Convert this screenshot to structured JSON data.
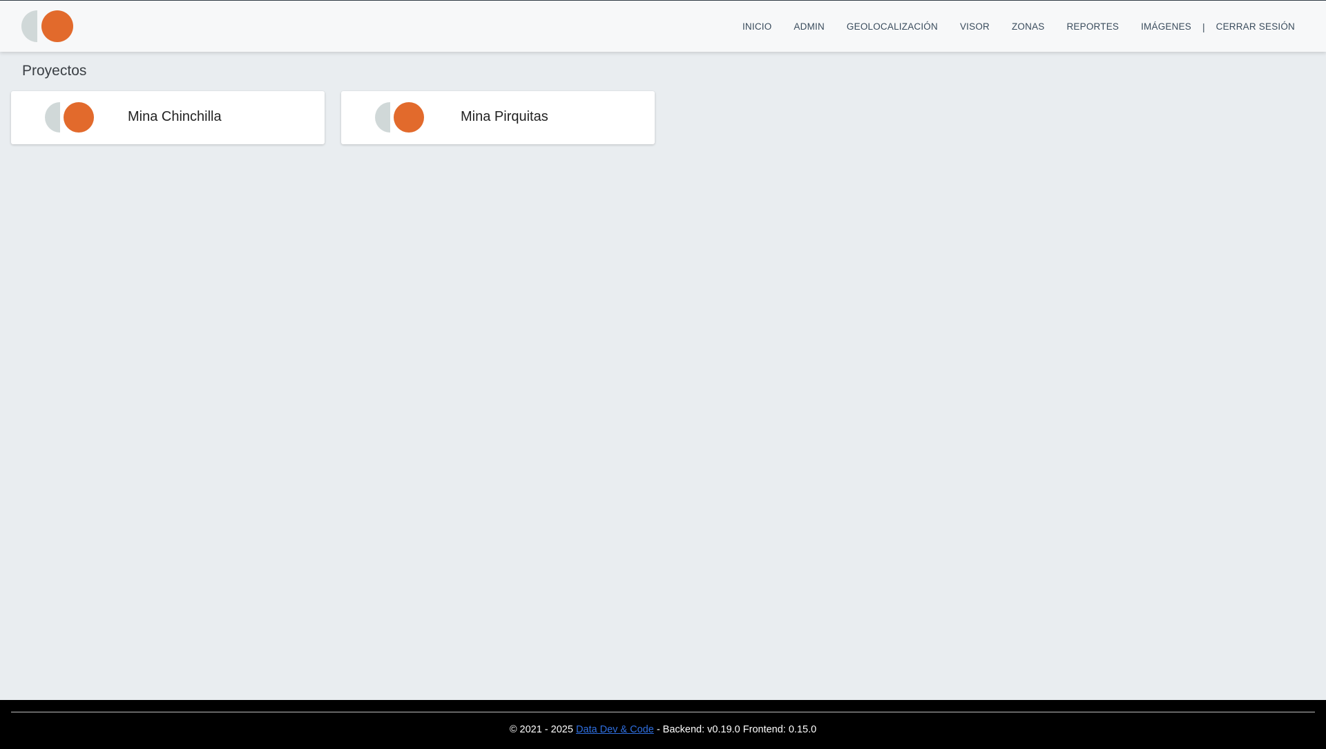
{
  "header": {
    "logo": "app-logo",
    "nav": [
      "INICIO",
      "ADMIN",
      "GEOLOCALIZACIÓN",
      "VISOR",
      "ZONAS",
      "REPORTES",
      "IMÁGENES"
    ],
    "separator": "|",
    "logout": "CERRAR SESIÓN"
  },
  "main": {
    "title": "Proyectos",
    "projects": [
      {
        "name": "Mina Chinchilla"
      },
      {
        "name": "Mina Pirquitas"
      }
    ]
  },
  "footer": {
    "prefix": "© 2021 - 2025 ",
    "link": "Data Dev & Code",
    "suffix": " - Backend: v0.19.0 Frontend: 0.15.0"
  },
  "colors": {
    "accent": "#e26a2c",
    "logo_gray": "#d0d8d8",
    "background": "#e9edf0",
    "footer_bg": "#000000",
    "link": "#2f6fe0"
  }
}
